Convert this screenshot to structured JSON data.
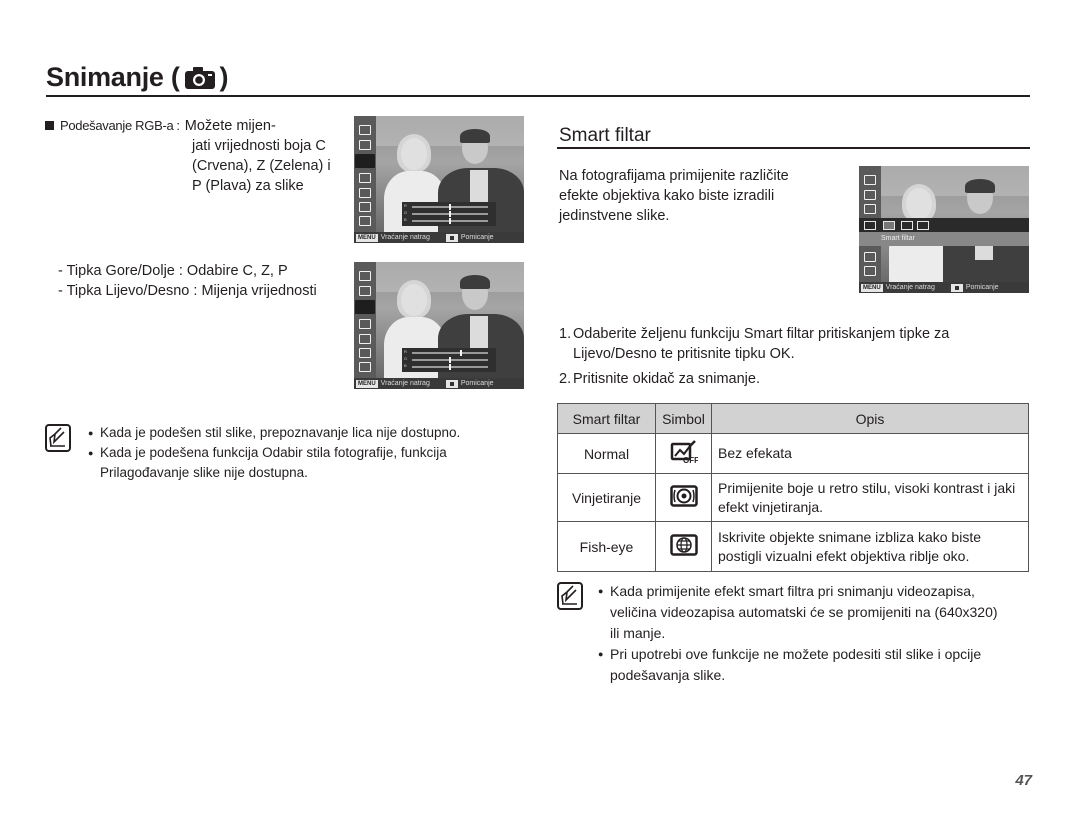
{
  "header": {
    "title": "Snimanje (",
    "title_close": ")",
    "icon": "camera-icon"
  },
  "left": {
    "rgb": {
      "label": "Podešavanje RGB-a",
      "separator": ":",
      "lines": [
        "Možete mijen-",
        "jati vrijednosti boja C",
        "(Crvena), Z (Zelena) i",
        "P (Plava) za slike"
      ]
    },
    "keys": [
      "- Tipka Gore/Dolje : Odabire C, Z, P",
      "- Tipka Lijevo/Desno : Mijenja vrijednosti"
    ],
    "screens": [
      {
        "menu_key": "MENU",
        "back_label": "Vraćanje natrag",
        "move_label": "Pomicanje",
        "rgb_levels": {
          "R": 0.5,
          "G": 0.5,
          "B": 0.5
        }
      },
      {
        "menu_key": "MENU",
        "back_label": "Vraćanje natrag",
        "move_label": "Pomicanje",
        "rgb_levels": {
          "R": 0.65,
          "G": 0.5,
          "B": 0.5
        }
      }
    ],
    "notes": [
      "Kada je podešen stil slike, prepoznavanje lica nije dostupno.",
      "Kada je podešena funkcija Odabir stila fotografije, funkcija Prilagođavanje slike nije dostupna."
    ]
  },
  "right": {
    "section_title": "Smart filtar",
    "intro": [
      "Na fotografijama primijenite različite",
      "efekte objektiva kako biste izradili",
      "jedinstvene slike."
    ],
    "screen": {
      "menu_label": "Smart filtar",
      "menu_key": "MENU",
      "back_label": "Vraćanje natrag",
      "move_label": "Pomicanje"
    },
    "steps": [
      {
        "num": "1.",
        "lines": [
          "Odaberite željenu funkciju Smart filtar pritiskanjem tipke za",
          "Lijevo/Desno te pritisnite tipku OK."
        ]
      },
      {
        "num": "2.",
        "lines": [
          "Pritisnite okidač za snimanje."
        ]
      }
    ],
    "table": {
      "headers": [
        "Smart filtar",
        "Simbol",
        "Opis"
      ],
      "rows": [
        {
          "name": "Normal",
          "symbol": "filter-off-icon",
          "desc": "Bez efekata"
        },
        {
          "name": "Vinjetiranje",
          "symbol": "vignette-icon",
          "desc": "Primijenite boje u retro stilu, visoki kontrast i jaki efekt vinjetiranja."
        },
        {
          "name": "Fish-eye",
          "symbol": "fisheye-icon",
          "desc": "Iskrivite objekte snimane izbliza kako biste postigli vizualni efekt objektiva riblje oko."
        }
      ]
    },
    "notes": [
      [
        "Kada primijenite efekt smart filtra pri snimanju videozapisa,",
        "veličina videozapisa automatski će se promijeniti na (640x320)",
        "ili manje."
      ],
      [
        "Pri upotrebi ove funkcije ne možete podesiti stil slike i opcije",
        "podešavanja slike."
      ]
    ]
  },
  "footer": {
    "page_number": "47"
  }
}
